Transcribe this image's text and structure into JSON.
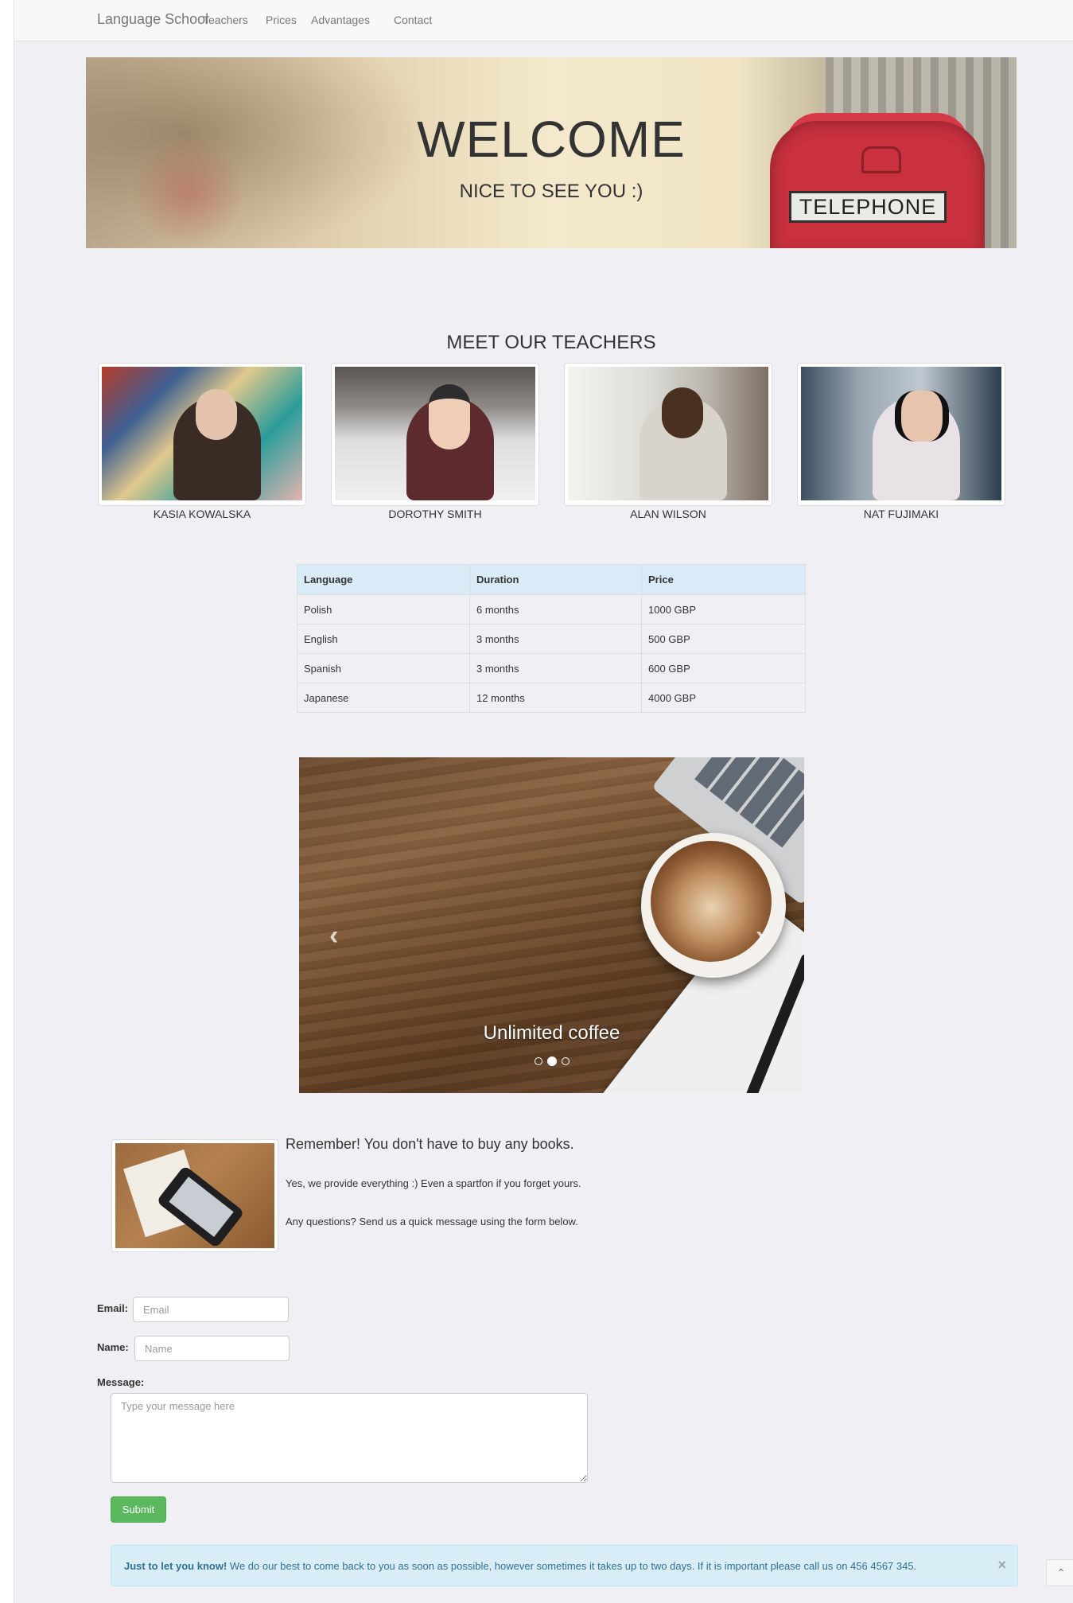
{
  "navbar": {
    "brand": "Language School",
    "items": [
      {
        "label": "Teachers"
      },
      {
        "label": "Prices"
      },
      {
        "label": "Advantages"
      },
      {
        "label": "Contact"
      }
    ]
  },
  "hero": {
    "title": "WELCOME",
    "subtitle": "NICE TO SEE YOU :)",
    "sign_text": "TELEPHONE"
  },
  "teachers": {
    "title": "MEET OUR TEACHERS",
    "list": [
      {
        "name": "KASIA KOWALSKA"
      },
      {
        "name": "DOROTHY SMITH"
      },
      {
        "name": "ALAN WILSON"
      },
      {
        "name": "NAT FUJIMAKI"
      }
    ]
  },
  "prices": {
    "headers": [
      "Language",
      "Duration",
      "Price"
    ],
    "rows": [
      [
        "Polish",
        "6 months",
        "1000 GBP"
      ],
      [
        "English",
        "3 months",
        "500 GBP"
      ],
      [
        "Spanish",
        "3 months",
        "600 GBP"
      ],
      [
        "Japanese",
        "12 months",
        "4000 GBP"
      ]
    ]
  },
  "carousel": {
    "caption": "Unlimited coffee",
    "prev_icon": "chevron-left-icon",
    "next_icon": "chevron-right-icon",
    "prev_glyph": "‹",
    "next_glyph": "›",
    "slide_count": 3,
    "active_slide": 2
  },
  "books": {
    "heading": "Remember! You don't have to buy any books.",
    "p1": "Yes, we provide everything :) Even a spartfon if you forget yours.",
    "p2": "Any questions? Send us a quick message using the form below."
  },
  "form": {
    "email_label": "Email:",
    "email_placeholder": "Email",
    "name_label": "Name:",
    "name_placeholder": "Name",
    "message_label": "Message:",
    "message_placeholder": "Type your message here",
    "submit_label": "Submit"
  },
  "alert": {
    "strong": "Just to let you know!",
    "text": " We do our best to come back to you as soon as possible, however sometimes it takes up to two days. If it is important please call us on 456 4567 345.",
    "close_glyph": "×"
  },
  "scroll_top": {
    "icon": "chevron-up-icon",
    "glyph": "⌃"
  },
  "colors": {
    "page_bg": "#f0f0f4",
    "table_header": "#d9ebf7",
    "submit": "#5cb85c",
    "alert_bg": "#d9edf7",
    "alert_text": "#31708f",
    "booth_red": "#c9313f"
  }
}
